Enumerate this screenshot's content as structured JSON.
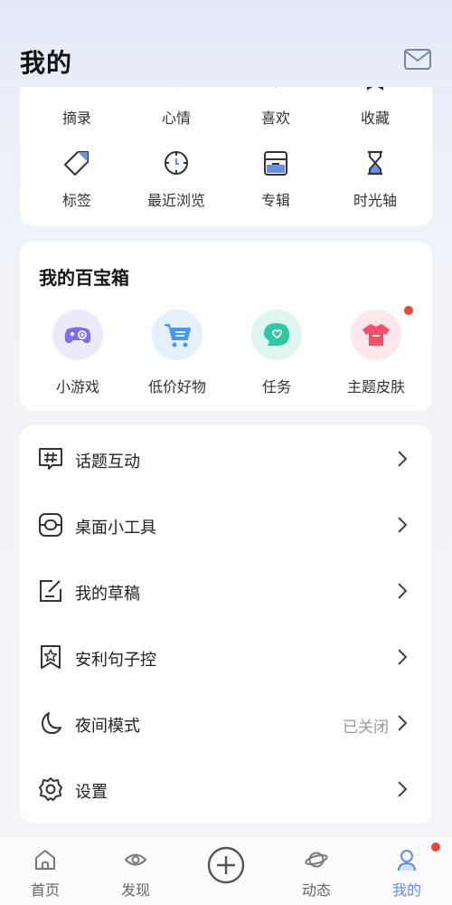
{
  "header": {
    "title": "我的",
    "mail_icon": "mail-icon"
  },
  "top_grid": [
    {
      "label": "摘录",
      "icon": "excerpt-icon"
    },
    {
      "label": "心情",
      "icon": "mood-icon"
    },
    {
      "label": "喜欢",
      "icon": "like-icon"
    },
    {
      "label": "收藏",
      "icon": "bookmark-icon"
    },
    {
      "label": "标签",
      "icon": "tag-icon"
    },
    {
      "label": "最近浏览",
      "icon": "clock-icon"
    },
    {
      "label": "专辑",
      "icon": "album-icon"
    },
    {
      "label": "时光轴",
      "icon": "hourglass-icon"
    }
  ],
  "toolbox": {
    "title": "我的百宝箱",
    "items": [
      {
        "label": "小游戏",
        "icon": "gamepad-icon",
        "color": "#7b6cf0"
      },
      {
        "label": "低价好物",
        "icon": "cart-icon",
        "color": "#3f9cf0"
      },
      {
        "label": "任务",
        "icon": "chat-bubble-icon",
        "color": "#2ec9a4"
      },
      {
        "label": "主题皮肤",
        "icon": "tshirt-icon",
        "color": "#f0506a",
        "has_badge": true
      }
    ]
  },
  "menu": [
    {
      "label": "话题互动",
      "icon": "hashtag-icon"
    },
    {
      "label": "桌面小工具",
      "icon": "widget-icon"
    },
    {
      "label": "我的草稿",
      "icon": "draft-icon"
    },
    {
      "label": "安利句子控",
      "icon": "star-bookmark-icon"
    },
    {
      "label": "夜间模式",
      "icon": "moon-icon",
      "status": "已关闭"
    },
    {
      "label": "设置",
      "icon": "gear-icon"
    }
  ],
  "bottom_nav": [
    {
      "label": "首页",
      "icon": "home-icon"
    },
    {
      "label": "发现",
      "icon": "eye-icon"
    },
    {
      "label": "",
      "icon": "plus-circle-icon"
    },
    {
      "label": "动态",
      "icon": "planet-icon"
    },
    {
      "label": "我的",
      "icon": "person-icon",
      "active": true,
      "has_badge": true
    }
  ],
  "colors": {
    "accent": "#5b8ce8",
    "badge": "#e5483b"
  }
}
